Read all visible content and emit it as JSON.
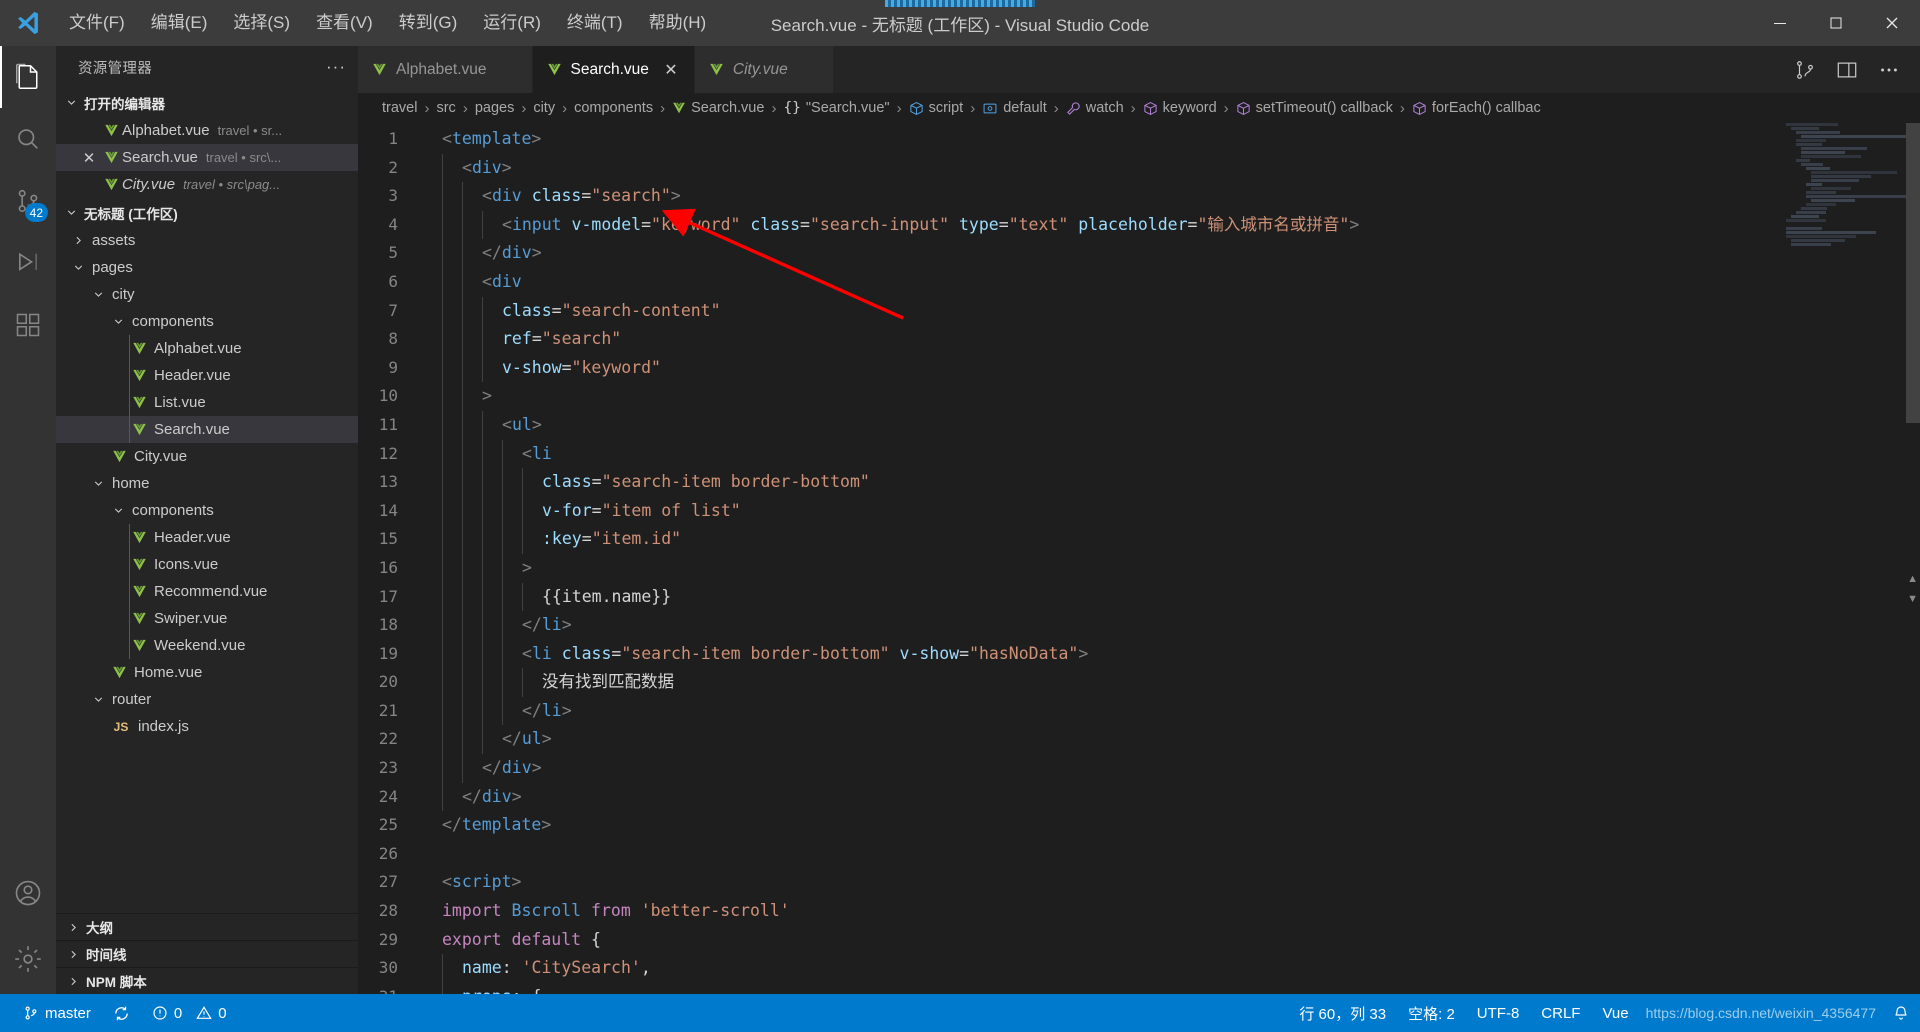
{
  "window": {
    "title": "Search.vue - 无标题 (工作区) - Visual Studio Code",
    "menus": [
      "文件(F)",
      "编辑(E)",
      "选择(S)",
      "查看(V)",
      "转到(G)",
      "运行(R)",
      "终端(T)",
      "帮助(H)"
    ],
    "controls": {
      "minimize": "minimize-button",
      "maximize": "maximize-button",
      "close": "close-button"
    }
  },
  "activitybar": {
    "items": [
      {
        "name": "explorer",
        "icon": "files-icon",
        "active": true
      },
      {
        "name": "search",
        "icon": "search-icon",
        "active": false
      },
      {
        "name": "source-control",
        "icon": "source-control-icon",
        "active": false,
        "badge": "42"
      },
      {
        "name": "run-debug",
        "icon": "run-debug-icon",
        "active": false
      },
      {
        "name": "extensions",
        "icon": "extensions-icon",
        "active": false
      },
      {
        "name": "accounts",
        "icon": "account-icon",
        "active": false
      },
      {
        "name": "settings",
        "icon": "gear-icon",
        "active": false
      }
    ]
  },
  "sidebar": {
    "title": "资源管理器",
    "more_label": "···",
    "open_editors": {
      "label": "打开的编辑器",
      "items": [
        {
          "label": "Alphabet.vue",
          "desc": "travel • sr...",
          "icon": "vue-icon",
          "selected": false,
          "italic": false,
          "closable": false
        },
        {
          "label": "Search.vue",
          "desc": "travel • src\\...",
          "icon": "vue-icon",
          "selected": true,
          "italic": false,
          "closable": true
        },
        {
          "label": "City.vue",
          "desc": "travel • src\\pag...",
          "icon": "vue-icon",
          "selected": false,
          "italic": true,
          "closable": false
        }
      ]
    },
    "workspace": {
      "label": "无标题 (工作区)",
      "items": [
        {
          "label": "assets",
          "type": "folder",
          "expanded": false,
          "depth": 1,
          "selected": false
        },
        {
          "label": "pages",
          "type": "folder",
          "expanded": true,
          "depth": 1,
          "selected": false
        },
        {
          "label": "city",
          "type": "folder",
          "expanded": true,
          "depth": 2,
          "selected": false
        },
        {
          "label": "components",
          "type": "folder",
          "expanded": true,
          "depth": 3,
          "selected": false
        },
        {
          "label": "Alphabet.vue",
          "type": "vue",
          "depth": 4,
          "selected": false
        },
        {
          "label": "Header.vue",
          "type": "vue",
          "depth": 4,
          "selected": false
        },
        {
          "label": "List.vue",
          "type": "vue",
          "depth": 4,
          "selected": false
        },
        {
          "label": "Search.vue",
          "type": "vue",
          "depth": 4,
          "selected": true
        },
        {
          "label": "City.vue",
          "type": "vue",
          "depth": 3,
          "selected": false
        },
        {
          "label": "home",
          "type": "folder",
          "expanded": true,
          "depth": 2,
          "selected": false
        },
        {
          "label": "components",
          "type": "folder",
          "expanded": true,
          "depth": 3,
          "selected": false
        },
        {
          "label": "Header.vue",
          "type": "vue",
          "depth": 4,
          "selected": false
        },
        {
          "label": "Icons.vue",
          "type": "vue",
          "depth": 4,
          "selected": false
        },
        {
          "label": "Recommend.vue",
          "type": "vue",
          "depth": 4,
          "selected": false
        },
        {
          "label": "Swiper.vue",
          "type": "vue",
          "depth": 4,
          "selected": false
        },
        {
          "label": "Weekend.vue",
          "type": "vue",
          "depth": 4,
          "selected": false
        },
        {
          "label": "Home.vue",
          "type": "vue",
          "depth": 3,
          "selected": false
        },
        {
          "label": "router",
          "type": "folder",
          "expanded": true,
          "depth": 2,
          "selected": false
        },
        {
          "label": "index.js",
          "type": "js",
          "depth": 3,
          "selected": false
        }
      ]
    },
    "panels": [
      "大纲",
      "时间线",
      "NPM 脚本"
    ]
  },
  "tabs": [
    {
      "label": "Alphabet.vue",
      "icon": "vue-icon",
      "active": false,
      "italic": false,
      "dirty": false
    },
    {
      "label": "Search.vue",
      "icon": "vue-icon",
      "active": true,
      "italic": false,
      "dirty": false
    },
    {
      "label": "City.vue",
      "icon": "vue-icon",
      "active": false,
      "italic": true,
      "dirty": false
    }
  ],
  "tab_actions": [
    "split-editor-icon",
    "toggle-panel-icon",
    "more-actions-icon"
  ],
  "breadcrumbs": [
    {
      "label": "travel",
      "icon": ""
    },
    {
      "label": "src",
      "icon": ""
    },
    {
      "label": "pages",
      "icon": ""
    },
    {
      "label": "city",
      "icon": ""
    },
    {
      "label": "components",
      "icon": ""
    },
    {
      "label": "Search.vue",
      "icon": "vue-icon"
    },
    {
      "label": "\"Search.vue\"",
      "icon": "braces-icon"
    },
    {
      "label": "script",
      "icon": "cube-blue-icon"
    },
    {
      "label": "default",
      "icon": "object-icon"
    },
    {
      "label": "watch",
      "icon": "wrench-icon"
    },
    {
      "label": "keyword",
      "icon": "cube-purple-icon"
    },
    {
      "label": "setTimeout() callback",
      "icon": "cube-purple-icon"
    },
    {
      "label": "forEach() callbac",
      "icon": "cube-purple-icon"
    }
  ],
  "editor": {
    "first_line": 1,
    "lines": [
      {
        "n": 1,
        "indent": 0,
        "tokens": [
          [
            "t-brk",
            "<"
          ],
          [
            "t-tag",
            "template"
          ],
          [
            "t-brk",
            ">"
          ]
        ]
      },
      {
        "n": 2,
        "indent": 1,
        "tokens": [
          [
            "t-brk",
            "<"
          ],
          [
            "t-tag",
            "div"
          ],
          [
            "t-brk",
            ">"
          ]
        ]
      },
      {
        "n": 3,
        "indent": 2,
        "tokens": [
          [
            "t-brk",
            "<"
          ],
          [
            "t-tag",
            "div"
          ],
          [
            "t-plain",
            " "
          ],
          [
            "t-attr",
            "class"
          ],
          [
            "t-eq",
            "="
          ],
          [
            "t-str",
            "\"search\""
          ],
          [
            "t-brk",
            ">"
          ]
        ]
      },
      {
        "n": 4,
        "indent": 3,
        "tokens": [
          [
            "t-brk",
            "<"
          ],
          [
            "t-tag",
            "input"
          ],
          [
            "t-plain",
            " "
          ],
          [
            "t-attr",
            "v-model"
          ],
          [
            "t-eq",
            "="
          ],
          [
            "t-str",
            "\"keyword\""
          ],
          [
            "t-plain",
            " "
          ],
          [
            "t-attr",
            "class"
          ],
          [
            "t-eq",
            "="
          ],
          [
            "t-str",
            "\"search-input\""
          ],
          [
            "t-plain",
            " "
          ],
          [
            "t-attr",
            "type"
          ],
          [
            "t-eq",
            "="
          ],
          [
            "t-str",
            "\"text\""
          ],
          [
            "t-plain",
            " "
          ],
          [
            "t-attr",
            "placeholder"
          ],
          [
            "t-eq",
            "="
          ],
          [
            "t-str",
            "\"输入城市名或拼音\""
          ],
          [
            "t-brk",
            ">"
          ]
        ]
      },
      {
        "n": 5,
        "indent": 2,
        "tokens": [
          [
            "t-brk",
            "</"
          ],
          [
            "t-tag",
            "div"
          ],
          [
            "t-brk",
            ">"
          ]
        ]
      },
      {
        "n": 6,
        "indent": 2,
        "tokens": [
          [
            "t-brk",
            "<"
          ],
          [
            "t-tag",
            "div"
          ]
        ]
      },
      {
        "n": 7,
        "indent": 3,
        "tokens": [
          [
            "t-attr",
            "class"
          ],
          [
            "t-eq",
            "="
          ],
          [
            "t-str",
            "\"search-content\""
          ]
        ]
      },
      {
        "n": 8,
        "indent": 3,
        "tokens": [
          [
            "t-attr",
            "ref"
          ],
          [
            "t-eq",
            "="
          ],
          [
            "t-str",
            "\"search\""
          ]
        ]
      },
      {
        "n": 9,
        "indent": 3,
        "tokens": [
          [
            "t-attr",
            "v-show"
          ],
          [
            "t-eq",
            "="
          ],
          [
            "t-str",
            "\"keyword\""
          ]
        ]
      },
      {
        "n": 10,
        "indent": 2,
        "tokens": [
          [
            "t-brk",
            ">"
          ]
        ]
      },
      {
        "n": 11,
        "indent": 3,
        "tokens": [
          [
            "t-brk",
            "<"
          ],
          [
            "t-tag",
            "ul"
          ],
          [
            "t-brk",
            ">"
          ]
        ]
      },
      {
        "n": 12,
        "indent": 4,
        "tokens": [
          [
            "t-brk",
            "<"
          ],
          [
            "t-tag",
            "li"
          ]
        ]
      },
      {
        "n": 13,
        "indent": 5,
        "tokens": [
          [
            "t-attr",
            "class"
          ],
          [
            "t-eq",
            "="
          ],
          [
            "t-str",
            "\"search-item border-bottom\""
          ]
        ]
      },
      {
        "n": 14,
        "indent": 5,
        "tokens": [
          [
            "t-attr",
            "v-for"
          ],
          [
            "t-eq",
            "="
          ],
          [
            "t-str",
            "\"item of list\""
          ]
        ]
      },
      {
        "n": 15,
        "indent": 5,
        "tokens": [
          [
            "t-attr",
            ":key"
          ],
          [
            "t-eq",
            "="
          ],
          [
            "t-str",
            "\"item.id\""
          ]
        ]
      },
      {
        "n": 16,
        "indent": 4,
        "tokens": [
          [
            "t-brk",
            ">"
          ]
        ]
      },
      {
        "n": 17,
        "indent": 5,
        "tokens": [
          [
            "t-plain",
            "{{"
          ],
          [
            "t-plain",
            "item.name"
          ],
          [
            "t-plain",
            "}}"
          ]
        ]
      },
      {
        "n": 18,
        "indent": 4,
        "tokens": [
          [
            "t-brk",
            "</"
          ],
          [
            "t-tag",
            "li"
          ],
          [
            "t-brk",
            ">"
          ]
        ]
      },
      {
        "n": 19,
        "indent": 4,
        "tokens": [
          [
            "t-brk",
            "<"
          ],
          [
            "t-tag",
            "li"
          ],
          [
            "t-plain",
            " "
          ],
          [
            "t-attr",
            "class"
          ],
          [
            "t-eq",
            "="
          ],
          [
            "t-str",
            "\"search-item border-bottom\""
          ],
          [
            "t-plain",
            " "
          ],
          [
            "t-attr",
            "v-show"
          ],
          [
            "t-eq",
            "="
          ],
          [
            "t-str",
            "\"hasNoData\""
          ],
          [
            "t-brk",
            ">"
          ]
        ]
      },
      {
        "n": 20,
        "indent": 5,
        "tokens": [
          [
            "t-plain",
            "没有找到匹配数据"
          ]
        ]
      },
      {
        "n": 21,
        "indent": 4,
        "tokens": [
          [
            "t-brk",
            "</"
          ],
          [
            "t-tag",
            "li"
          ],
          [
            "t-brk",
            ">"
          ]
        ]
      },
      {
        "n": 22,
        "indent": 3,
        "tokens": [
          [
            "t-brk",
            "</"
          ],
          [
            "t-tag",
            "ul"
          ],
          [
            "t-brk",
            ">"
          ]
        ]
      },
      {
        "n": 23,
        "indent": 2,
        "tokens": [
          [
            "t-brk",
            "</"
          ],
          [
            "t-tag",
            "div"
          ],
          [
            "t-brk",
            ">"
          ]
        ]
      },
      {
        "n": 24,
        "indent": 1,
        "tokens": [
          [
            "t-brk",
            "</"
          ],
          [
            "t-tag",
            "div"
          ],
          [
            "t-brk",
            ">"
          ]
        ]
      },
      {
        "n": 25,
        "indent": 0,
        "tokens": [
          [
            "t-brk",
            "</"
          ],
          [
            "t-tag",
            "template"
          ],
          [
            "t-brk",
            ">"
          ]
        ]
      },
      {
        "n": 26,
        "indent": 0,
        "tokens": []
      },
      {
        "n": 27,
        "indent": 0,
        "tokens": [
          [
            "t-brk",
            "<"
          ],
          [
            "t-tag",
            "script"
          ],
          [
            "t-brk",
            ">"
          ]
        ]
      },
      {
        "n": 28,
        "indent": 0,
        "tokens": [
          [
            "t-kw",
            "import"
          ],
          [
            "t-plain",
            " "
          ],
          [
            "t-mus",
            "Bscroll"
          ],
          [
            "t-plain",
            " "
          ],
          [
            "t-kw",
            "from"
          ],
          [
            "t-plain",
            " "
          ],
          [
            "t-str",
            "'better-scroll'"
          ]
        ]
      },
      {
        "n": 29,
        "indent": 0,
        "tokens": [
          [
            "t-kw",
            "export"
          ],
          [
            "t-plain",
            " "
          ],
          [
            "t-kw",
            "default"
          ],
          [
            "t-plain",
            " "
          ],
          [
            "t-punc",
            "{"
          ]
        ]
      },
      {
        "n": 30,
        "indent": 1,
        "tokens": [
          [
            "t-prop",
            "name"
          ],
          [
            "t-punc",
            ": "
          ],
          [
            "t-str",
            "'CitySearch'"
          ],
          [
            "t-punc",
            ","
          ]
        ]
      },
      {
        "n": 31,
        "indent": 1,
        "tokens": [
          [
            "t-prop",
            "props"
          ],
          [
            "t-punc",
            ": {"
          ]
        ]
      }
    ]
  },
  "statusbar": {
    "left": [
      {
        "icon": "source-control-icon",
        "label": "master"
      },
      {
        "icon": "sync-icon",
        "label": ""
      },
      {
        "icon": "error-warning-icon",
        "label": "0  0"
      }
    ],
    "errors": "0",
    "warnings": "0",
    "branch": "master",
    "right": [
      {
        "name": "cursor-position",
        "label": "行 60，列 33"
      },
      {
        "name": "indentation",
        "label": "空格: 2"
      },
      {
        "name": "encoding",
        "label": "UTF-8"
      },
      {
        "name": "eol",
        "label": "CRLF"
      },
      {
        "name": "language-mode",
        "label": "Vue"
      },
      {
        "name": "notifications",
        "label": ""
      }
    ],
    "watermark": "https://blog.csdn.net/weixin_4356477"
  },
  "colors": {
    "accent": "#007acc",
    "titlebar": "#3c3c3c",
    "sidebar": "#252526",
    "editor": "#1e1e1e",
    "activitybar": "#333333",
    "vue_green": "#8dc149",
    "selection": "#37373d"
  }
}
